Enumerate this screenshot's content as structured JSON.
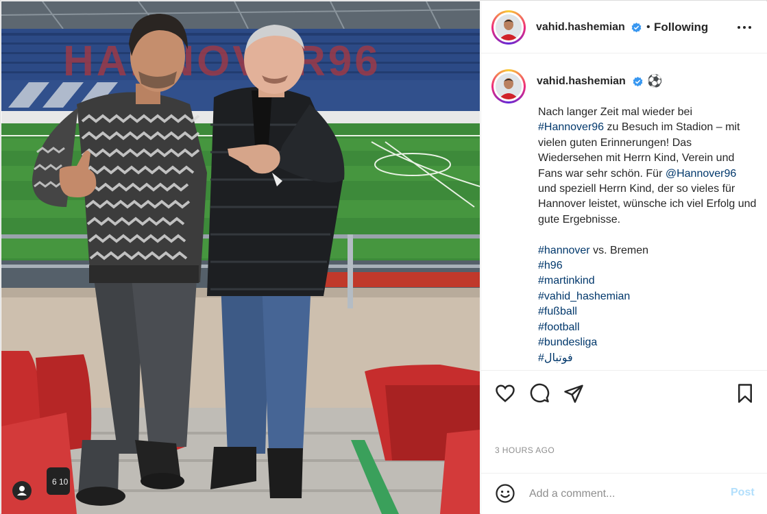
{
  "post": {
    "author": {
      "username": "vahid.hashemian",
      "verified": true
    },
    "follow_status": "Following",
    "separator": "•",
    "caption": {
      "username": "vahid.hashemian",
      "emoji": "⚽",
      "body_lines": [
        "Nach langer Zeit mal wieder bei"
      ],
      "segments": [
        {
          "text": "Nach langer Zeit mal wieder bei\n",
          "tag": false
        },
        {
          "text": "#Hannover96",
          "tag": true
        },
        {
          "text": " zu Besuch im Stadion – mit vielen guten Erinnerungen! Das Wiedersehen mit Herrn Kind, Verein und Fans war sehr schön. Für ",
          "tag": false
        },
        {
          "text": "@Hannover96",
          "tag": true
        },
        {
          "text": " und speziell Herrn Kind, der so vieles für Hannover leistet, wünsche ich viel Erfolg und gute Ergebnisse.\n\n",
          "tag": false
        },
        {
          "text": "#hannover",
          "tag": true
        },
        {
          "text": " vs. Bremen\n",
          "tag": false
        },
        {
          "text": "#h96",
          "tag": true
        },
        {
          "text": "\n",
          "tag": false
        },
        {
          "text": "#martinkind",
          "tag": true
        },
        {
          "text": "\n",
          "tag": false
        },
        {
          "text": "#vahid_hashemian",
          "tag": true
        },
        {
          "text": "\n",
          "tag": false
        },
        {
          "text": "#fußball",
          "tag": true
        },
        {
          "text": "\n",
          "tag": false
        },
        {
          "text": "#football",
          "tag": true
        },
        {
          "text": "\n",
          "tag": false
        },
        {
          "text": "#bundesliga",
          "tag": true
        },
        {
          "text": "\n",
          "tag": false
        },
        {
          "text": "#فوتبال",
          "tag": true
        }
      ]
    },
    "timestamp": "3 HOURS AGO",
    "comment": {
      "placeholder": "Add a comment...",
      "post_label": "Post"
    },
    "photo": {
      "stadium_lettering": "HANNOVER96",
      "seat_label": "6 10"
    }
  },
  "icons": {
    "more": "more-options-icon",
    "like": "heart-icon",
    "comment": "comment-icon",
    "share": "paper-plane-icon",
    "save": "bookmark-icon",
    "emoji": "smiley-icon",
    "verified": "verified-badge-icon",
    "user_tag": "user-tag-icon"
  },
  "colors": {
    "link": "#00376b",
    "verified": "#3897f0",
    "post_disabled": "#b2dffc",
    "muted": "#8e8e8e"
  }
}
